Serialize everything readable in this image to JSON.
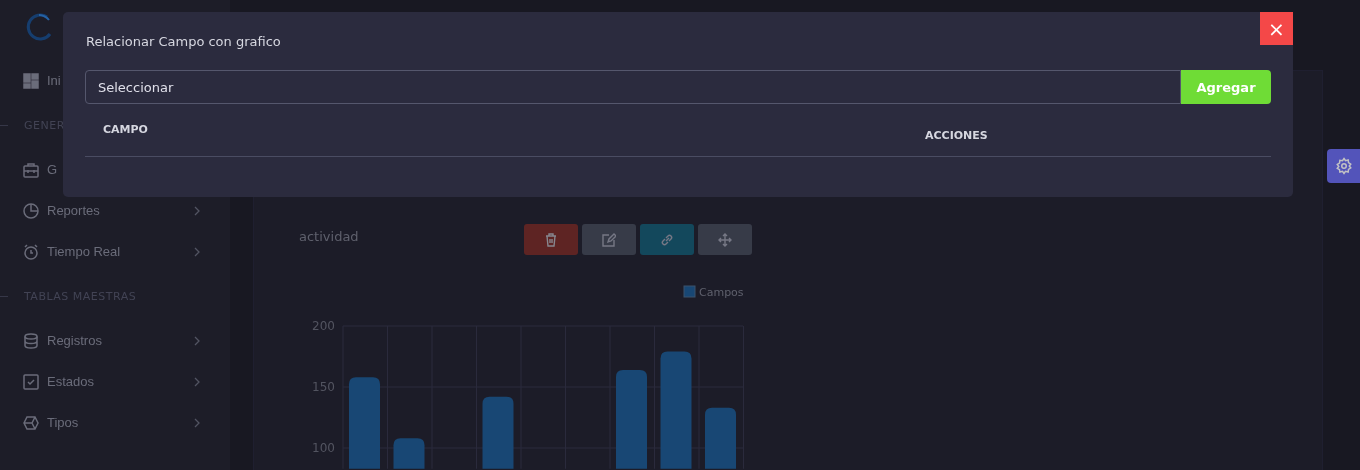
{
  "sidebar": {
    "items": [
      {
        "kind": "item",
        "label": "Ini",
        "submenu": false
      },
      {
        "kind": "section",
        "label": "GENER"
      },
      {
        "kind": "item",
        "label": "G",
        "submenu": false
      },
      {
        "kind": "item",
        "label": "Reportes",
        "submenu": true
      },
      {
        "kind": "item",
        "label": "Tiempo Real",
        "submenu": true
      },
      {
        "kind": "section",
        "label": "TABLAS MAESTRAS"
      },
      {
        "kind": "item",
        "label": "Registros",
        "submenu": true
      },
      {
        "kind": "item",
        "label": "Estados",
        "submenu": true
      },
      {
        "kind": "item",
        "label": "Tipos",
        "submenu": true
      }
    ]
  },
  "card": {
    "title": "actividad",
    "actions": [
      {
        "kind": "delete"
      },
      {
        "kind": "edit"
      },
      {
        "kind": "link"
      },
      {
        "kind": "move"
      }
    ],
    "chart_data": {
      "type": "bar",
      "series": [
        {
          "name": "Campos",
          "color": "#1c5b94",
          "values": [
            158,
            108,
            null,
            142,
            null,
            null,
            164,
            179,
            133
          ]
        }
      ],
      "yticks": [
        100,
        150,
        200
      ],
      "ylim": [
        83,
        200
      ]
    }
  },
  "modal": {
    "title": "Relacionar Campo con grafico",
    "select": {
      "placeholder": "Seleccionar"
    },
    "add_button": "Agregar",
    "close": "×",
    "columns": [
      "CAMPO",
      "ACCIONES"
    ]
  }
}
